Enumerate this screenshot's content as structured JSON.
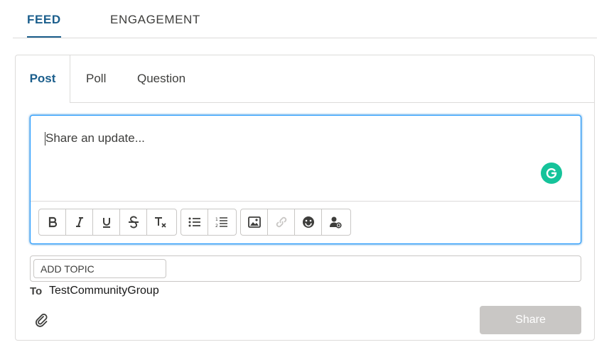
{
  "top_tabs": [
    {
      "label": "FEED",
      "active": true
    },
    {
      "label": "ENGAGEMENT",
      "active": false
    }
  ],
  "composer": {
    "tabs": [
      {
        "label": "Post",
        "active": true
      },
      {
        "label": "Poll",
        "active": false
      },
      {
        "label": "Question",
        "active": false
      }
    ],
    "placeholder": "Share an update...",
    "toolbar_groups": [
      [
        "bold-icon",
        "italic-icon",
        "underline-icon",
        "strikethrough-icon",
        "clear-formatting-icon"
      ],
      [
        "bulleted-list-icon",
        "numbered-list-icon"
      ],
      [
        "image-icon",
        "link-icon",
        "emoji-icon",
        "mention-user-icon"
      ]
    ],
    "add_topic_label": "ADD TOPIC",
    "to_label": "To",
    "to_value": "TestCommunityGroup",
    "share_label": "Share"
  },
  "colors": {
    "accent": "#1b5e8c",
    "focus_border": "#1b96ff",
    "grammarly": "#15c39a",
    "share_disabled": "#c9c7c5"
  }
}
